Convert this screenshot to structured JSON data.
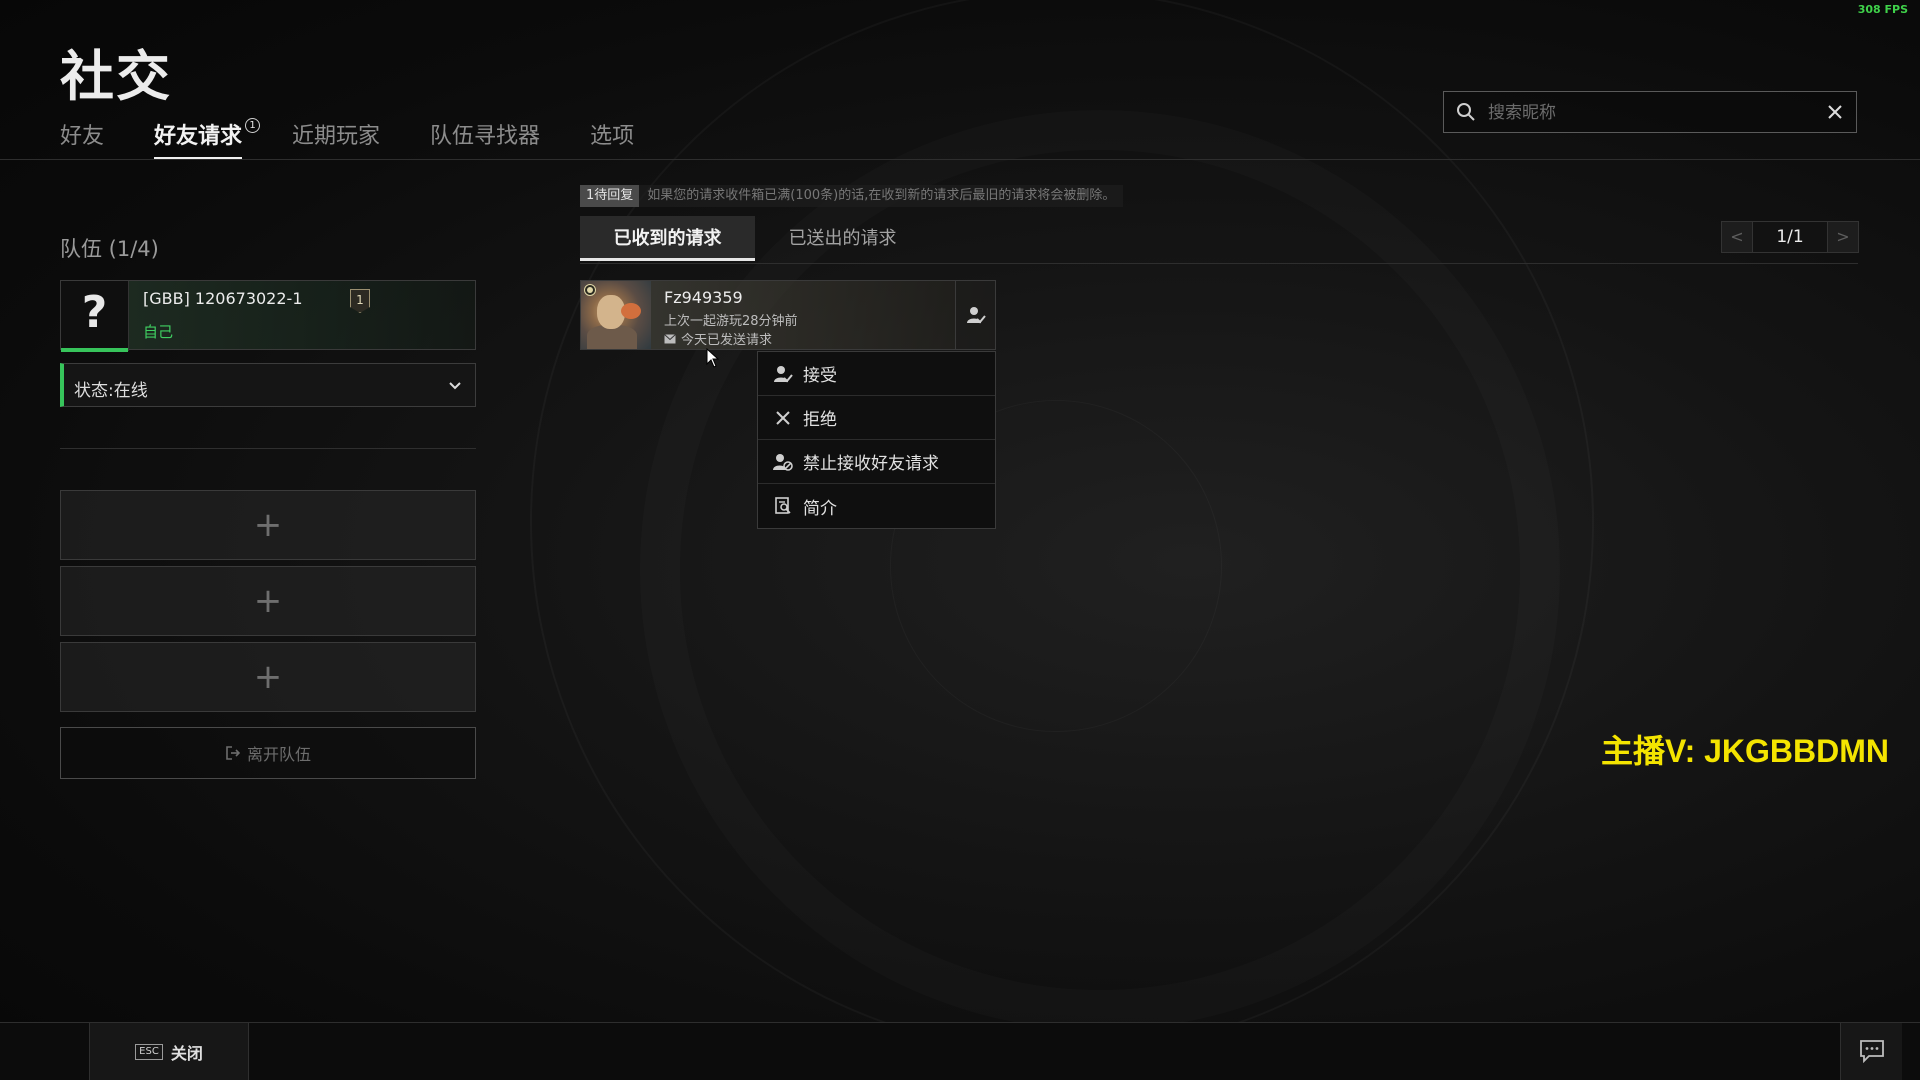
{
  "fps": "308 FPS",
  "page": {
    "title": "社交"
  },
  "tabs": [
    {
      "label": "好友",
      "active": false
    },
    {
      "label": "好友请求",
      "active": true,
      "badge": "1"
    },
    {
      "label": "近期玩家",
      "active": false
    },
    {
      "label": "队伍寻找器",
      "active": false
    },
    {
      "label": "选项",
      "active": false
    }
  ],
  "search": {
    "placeholder": "搜索昵称",
    "value": ""
  },
  "team": {
    "label": "队伍 (1/4)",
    "self": {
      "avatar_glyph": "?",
      "name": "[GBB] 120673022-1",
      "level": "1",
      "tag": "自己"
    },
    "status": "状态:在线",
    "empty_slot_glyph": "+",
    "leave_label": "离开队伍"
  },
  "requests": {
    "notice_tag": "1待回复",
    "notice_text": "如果您的请求收件箱已满(100条)的话,在收到新的请求后最旧的请求将会被删除。",
    "subtabs": [
      {
        "label": "已收到的请求",
        "active": true
      },
      {
        "label": "已送出的请求",
        "active": false
      }
    ],
    "pager": {
      "prev": "<",
      "page": "1/1",
      "next": ">"
    },
    "items": [
      {
        "name": "Fz949359",
        "last_played": "上次一起游玩28分钟前",
        "sent": "今天已发送请求"
      }
    ]
  },
  "context_menu": [
    {
      "icon": "accept-user-icon",
      "label": "接受"
    },
    {
      "icon": "close-icon",
      "label": "拒绝"
    },
    {
      "icon": "block-user-icon",
      "label": "禁止接收好友请求"
    },
    {
      "icon": "profile-icon",
      "label": "简介"
    }
  ],
  "watermark": "主播V: JKGBBDMN",
  "bottom": {
    "esc_key": "ESC",
    "close_label": "关闭"
  },
  "colors": {
    "accent_green": "#37c45b",
    "watermark_yellow": "#f4e400",
    "fps_green": "#3fd14a"
  }
}
